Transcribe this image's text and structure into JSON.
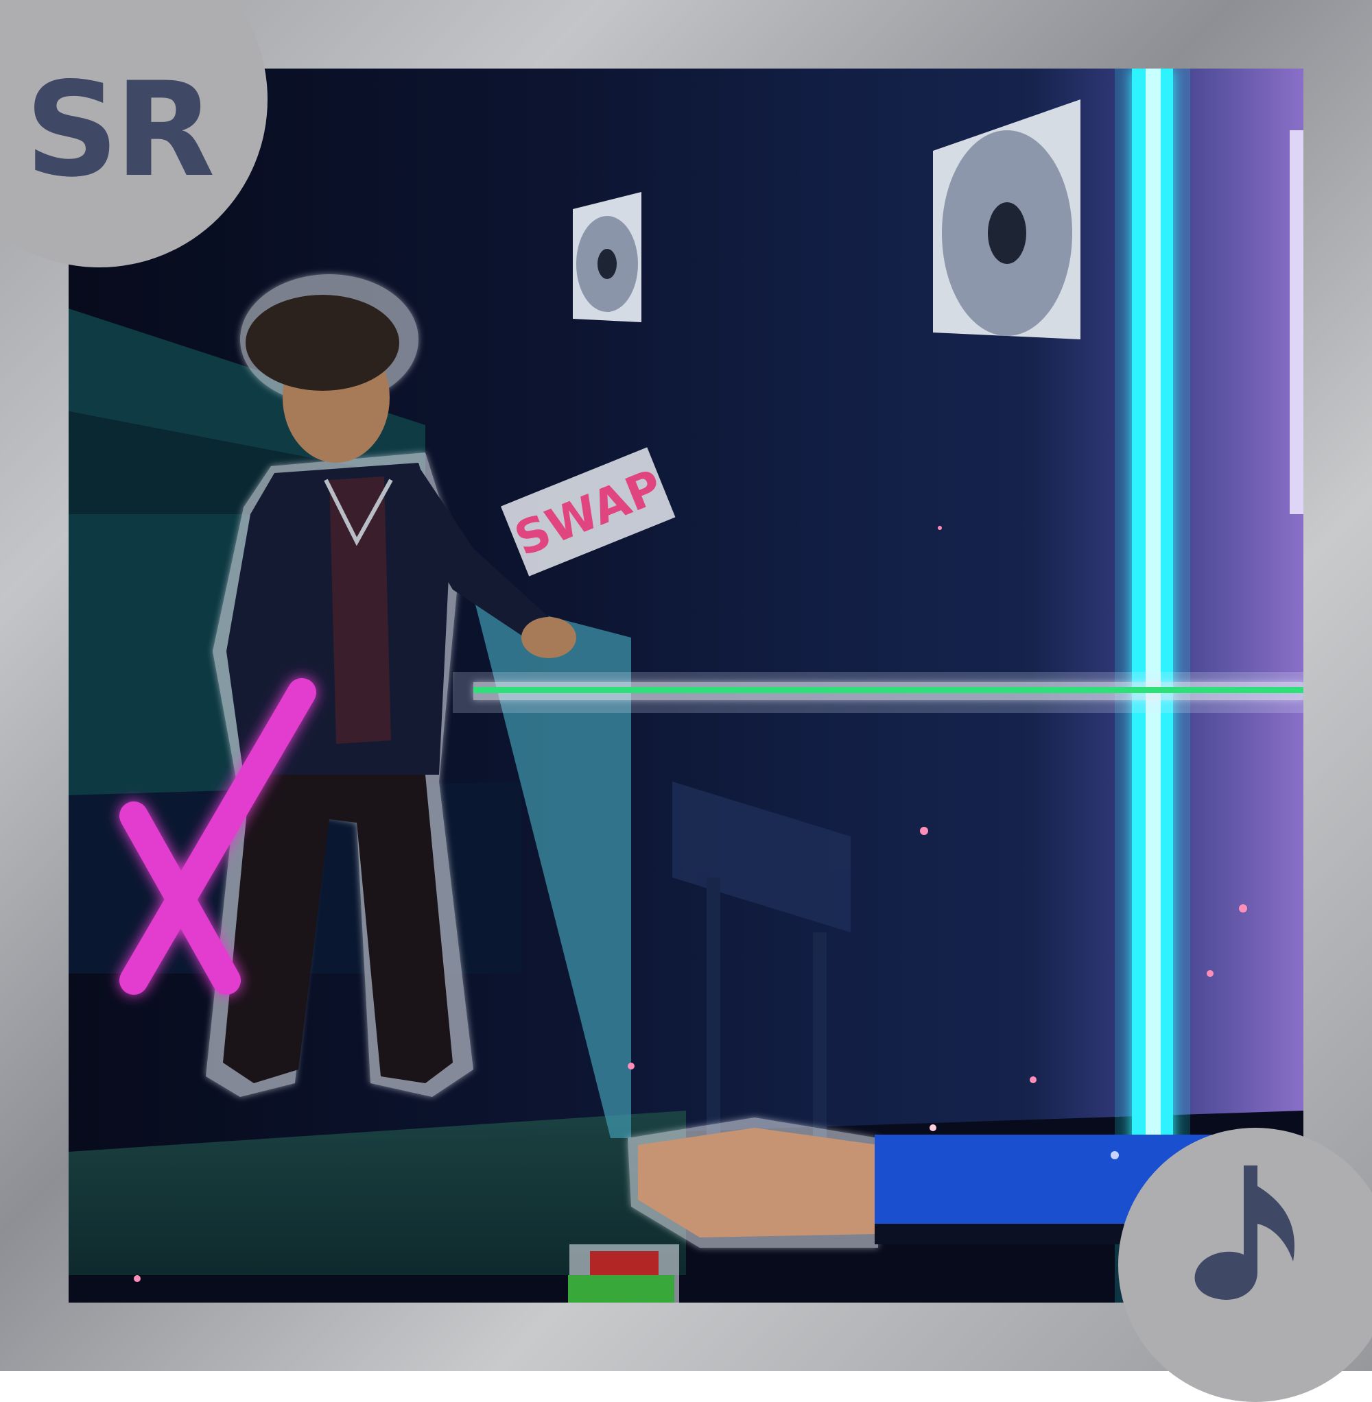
{
  "game": {
    "logo_text": "SR",
    "sign_text": "SWAP",
    "icons": {
      "logo": "sr-logo-badge",
      "music": "music-note-icon",
      "fail": "x-mark-icon"
    },
    "colors": {
      "frame": "#a9aaad",
      "badge_bg": "#aeaeb1",
      "badge_text": "#3f4864",
      "beam_vertical": "#2ff3ff",
      "beam_horizontal": "#2fe07a",
      "fail_mark": "#e23ccf",
      "sleeve": "#1a4fd0",
      "button_top": "#b32626",
      "button_base": "#39a83a"
    }
  }
}
